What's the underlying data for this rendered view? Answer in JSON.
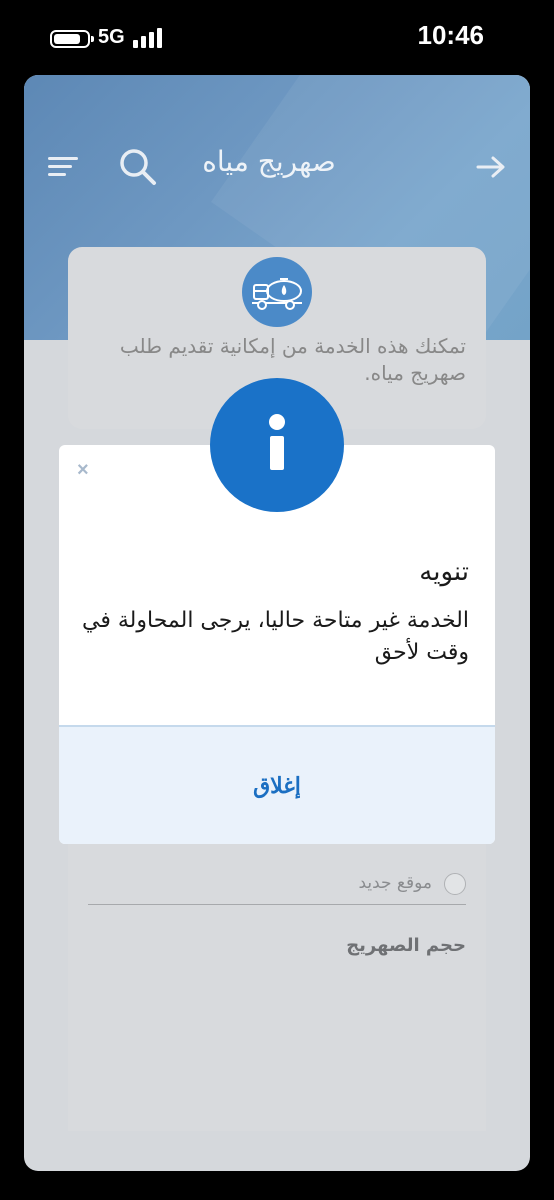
{
  "status_bar": {
    "network": "5G",
    "time": "10:46"
  },
  "header": {
    "title": "صهريج مياه",
    "icons": [
      "menu-icon",
      "search-icon",
      "back-arrow-icon"
    ]
  },
  "service_card": {
    "icon": "water-truck-icon",
    "description": "تمكنك هذه الخدمة من إمكانية تقديم طلب صهريج مياه."
  },
  "form": {
    "radio_option": "موقع جديد",
    "tank_size_label": "حجم الصهريج"
  },
  "dialog": {
    "icon": "info-icon",
    "close_symbol": "×",
    "title": "تنويه",
    "message": "الخدمة غير متاحة حاليا، يرجى المحاولة في وقت لأحق",
    "close_button_label": "إغلاق"
  },
  "colors": {
    "accent": "#1a72c8",
    "header_gradient_start": "#5d88b5",
    "dialog_footer": "#eaf2fb"
  }
}
